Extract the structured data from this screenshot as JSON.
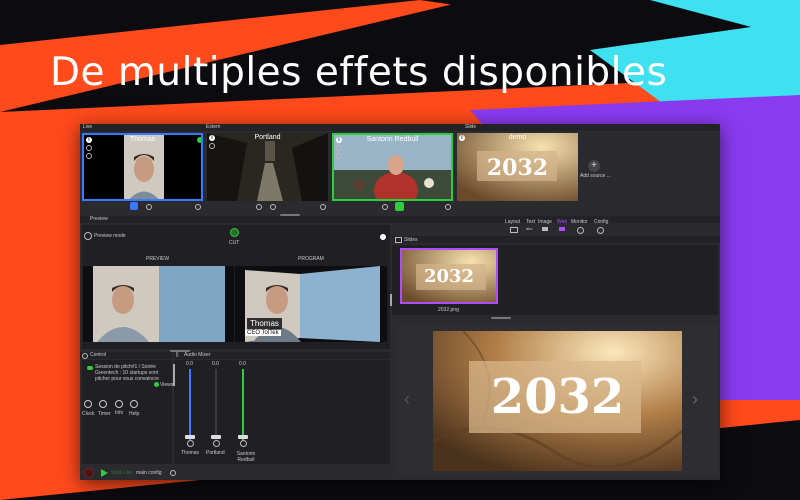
{
  "headline": "De multiples effets disponibles",
  "colors": {
    "orange": "#ff4a1c",
    "purple": "#8a3bf0",
    "cyan": "#3fe0f0",
    "live_border": "#3a78ff",
    "green": "#2ecc40"
  },
  "sources": {
    "live_label": "Live",
    "extern_label": "Extern",
    "slide_label": "Slide",
    "add_source": "Add source ...",
    "thumbs": [
      "Thomas",
      "Portland",
      "Santorin Redbull",
      "demo"
    ]
  },
  "preview": {
    "section": "Preview",
    "mode": "Preview mode",
    "cut": "CUT",
    "preview_label": "PREVIEW",
    "program_label": "PROGRAM",
    "lower_third_name": "Thomas",
    "lower_third_title": "CEO TolTek"
  },
  "toolbar": [
    "Layout",
    "Text",
    "Image",
    "Web",
    "Monitor",
    "Config"
  ],
  "toolbar_sub": "abc",
  "slides": {
    "label": "Slides",
    "file": "2032.png",
    "big_text": "2032"
  },
  "control": {
    "label": "Control",
    "session_text": "Session de pitch#1 / Soirée Greentech : 10 startups vont pitcher pour vous convaincre",
    "views": "Views",
    "buttons": [
      "Clock",
      "Timer",
      "Info",
      "Help"
    ],
    "start_live": "Start Live",
    "config": "main config"
  },
  "mixer": {
    "label": "Audio Mixer",
    "channels": [
      {
        "name": "Thomas",
        "value": "0.0"
      },
      {
        "name": "Portland",
        "value": "0.0"
      },
      {
        "name": "Santorin Redbull",
        "value": "0.0"
      }
    ]
  }
}
